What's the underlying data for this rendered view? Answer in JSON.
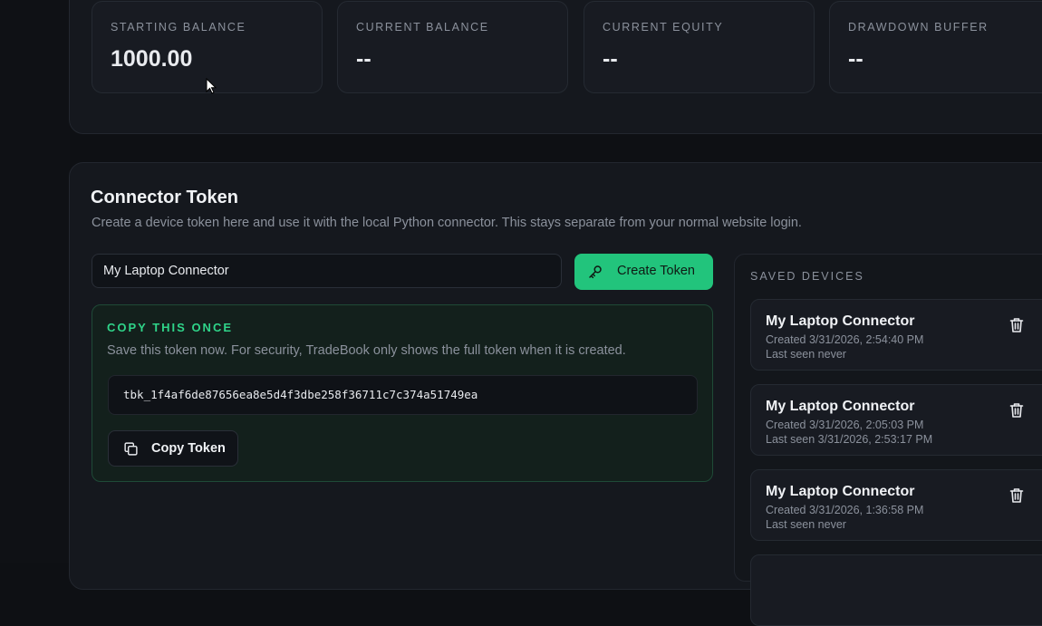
{
  "stats": [
    {
      "label": "STARTING BALANCE",
      "value": "1000.00"
    },
    {
      "label": "CURRENT BALANCE",
      "value": "--"
    },
    {
      "label": "CURRENT EQUITY",
      "value": "--"
    },
    {
      "label": "DRAWDOWN BUFFER",
      "value": "--"
    }
  ],
  "connector": {
    "title": "Connector Token",
    "subtitle": "Create a device token here and use it with the local Python connector. This stays separate from your normal website login.",
    "name_input_value": "My Laptop Connector",
    "create_label": "Create Token",
    "create_icon": "key-icon",
    "copy_heading": "COPY THIS ONCE",
    "copy_desc": "Save this token now. For security, TradeBook only shows the full token when it is created.",
    "token": "tbk_1f4af6de87656ea8e5d4f3dbe258f36711c7c374a51749ea",
    "copy_label": "Copy Token",
    "copy_icon": "copy-icon"
  },
  "devices": {
    "heading": "SAVED DEVICES",
    "items": [
      {
        "name": "My Laptop Connector",
        "created": "Created 3/31/2026, 2:54:40 PM",
        "last_seen": "Last seen never"
      },
      {
        "name": "My Laptop Connector",
        "created": "Created 3/31/2026, 2:05:03 PM",
        "last_seen": "Last seen 3/31/2026, 2:53:17 PM"
      },
      {
        "name": "My Laptop Connector",
        "created": "Created 3/31/2026, 1:36:58 PM",
        "last_seen": "Last seen never"
      }
    ]
  },
  "colors": {
    "accent": "#22c47c",
    "background": "#0e1014",
    "panel": "#15181e"
  }
}
